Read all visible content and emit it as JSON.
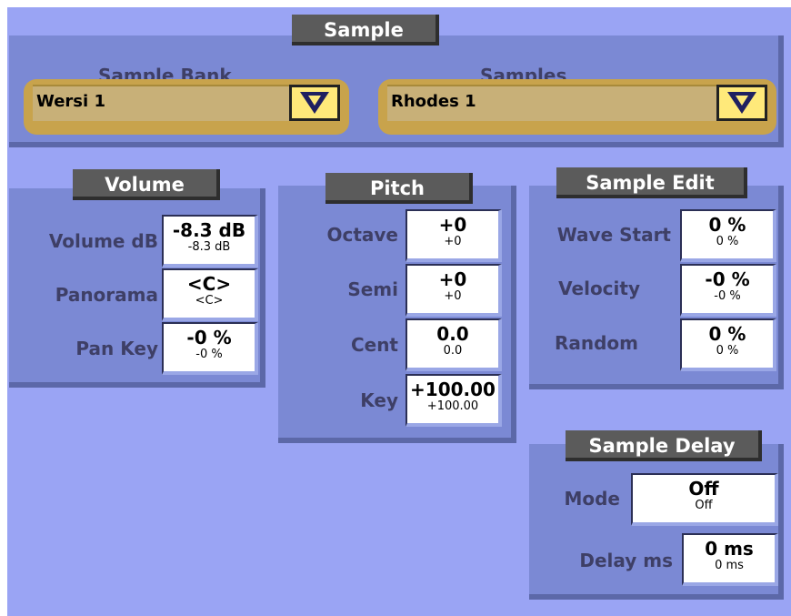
{
  "sample": {
    "title": "Sample",
    "bank_label": "Sample Bank",
    "bank_value": "Wersi 1",
    "samples_label": "Samples",
    "samples_value": "Rhodes 1"
  },
  "volume": {
    "title": "Volume",
    "rows": [
      {
        "label": "Volume dB",
        "value": "-8.3 dB",
        "sub": "-8.3 dB"
      },
      {
        "label": "Panorama",
        "value": "<C>",
        "sub": "<C>"
      },
      {
        "label": "Pan Key",
        "value": "-0 %",
        "sub": "-0 %"
      }
    ]
  },
  "pitch": {
    "title": "Pitch",
    "rows": [
      {
        "label": "Octave",
        "value": "+0",
        "sub": "+0"
      },
      {
        "label": "Semi",
        "value": "+0",
        "sub": "+0"
      },
      {
        "label": "Cent",
        "value": "0.0",
        "sub": "0.0"
      },
      {
        "label": "Key",
        "value": "+100.00",
        "sub": "+100.00"
      }
    ]
  },
  "sample_edit": {
    "title": "Sample Edit",
    "rows": [
      {
        "label": "Wave Start",
        "value": "0 %",
        "sub": "0 %"
      },
      {
        "label": "Velocity",
        "value": "-0 %",
        "sub": "-0 %"
      },
      {
        "label": "Random",
        "value": "0 %",
        "sub": "0 %"
      }
    ]
  },
  "sample_delay": {
    "title": "Sample Delay",
    "rows": [
      {
        "label": "Mode",
        "value": "Off",
        "sub": "Off"
      },
      {
        "label": "Delay ms",
        "value": "0 ms",
        "sub": "0 ms"
      }
    ]
  },
  "icons": {
    "dropdown": "chevron-down-icon"
  },
  "colors": {
    "background": "#9aa4f4",
    "panel": "#7b89d4",
    "title_bar": "#5b5b5b",
    "selector": "#c8a34c",
    "dropdown_button": "#ffe97a"
  }
}
